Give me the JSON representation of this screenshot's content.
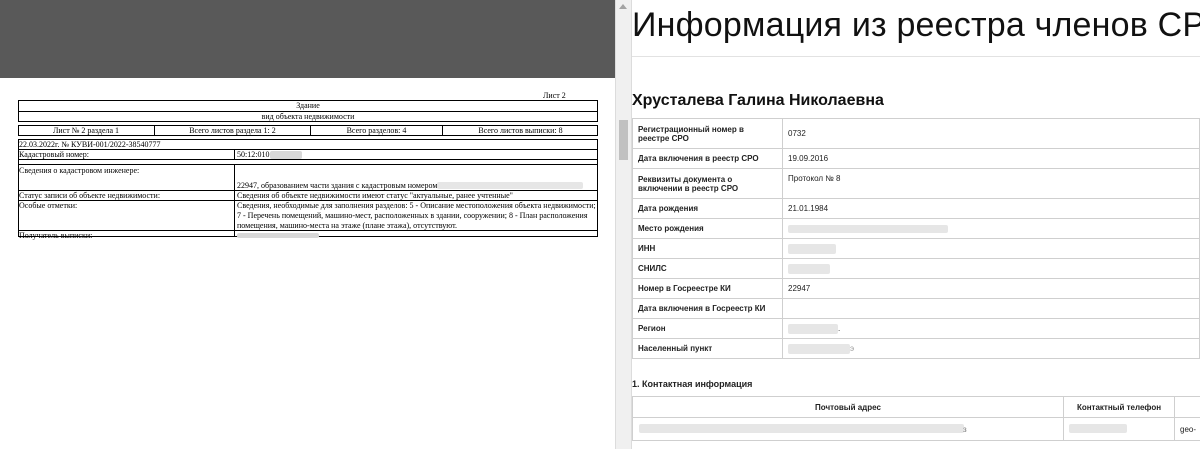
{
  "pdf": {
    "sheet_label": "Лист 2",
    "title": "Здание",
    "subtitle": "вид объекта недвижимости",
    "header_cells": [
      "Лист № 2 раздела 1",
      "Всего листов раздела 1: 2",
      "Всего разделов: 4",
      "Всего листов выписки: 8"
    ],
    "statement_line": "22.03.2022г. № КУВИ-001/2022-38540777",
    "cadastral_label": "Кадастровый номер:",
    "cadastral_value": "50:12:010",
    "engineer_label": "Сведения о кадастровом инженере:",
    "engineer_value": "22947, образованием части здания с кадастровым номером:",
    "status_label": "Статус записи об объекте недвижимости:",
    "status_value": "Сведения об объекте недвижимости имеют статус \"актуальные, ранее учтенные\"",
    "notes_label": "Особые отметки:",
    "notes_lines": [
      "Сведения, необходимые для заполнения разделов: 5 - Описание местоположения объекта недвижимости;",
      "7 - Перечень помещений, машино-мест, расположенных в здании, сооружении; 8 - План расположения",
      "помещения, машино-места на этаже (плане этажа), отсутствуют."
    ],
    "recipient_label": "Получатель выписки:"
  },
  "registry": {
    "page_title": "Информация из реестра членов СРО",
    "person_name": "Хрусталева Галина Николаевна",
    "rows": [
      {
        "label": "Регистрационный номер в реестре СРО",
        "value": "0732"
      },
      {
        "label": "Дата включения в реестр СРО",
        "value": "19.09.2016"
      },
      {
        "label": "Реквизиты документа о включении в реестр СРО",
        "value": "Протокол № 8"
      },
      {
        "label": "Дата рождения",
        "value": "21.01.1984"
      },
      {
        "label": "Место рождения",
        "value": ""
      },
      {
        "label": "ИНН",
        "value": ""
      },
      {
        "label": "СНИЛС",
        "value": ""
      },
      {
        "label": "Номер в Госреестре КИ",
        "value": "22947"
      },
      {
        "label": "Дата включения в Госреестр КИ",
        "value": ""
      },
      {
        "label": "Регион",
        "value": "."
      },
      {
        "label": "Населенный пункт",
        "value": "э"
      }
    ],
    "contacts_heading": "1. Контактная информация",
    "contacts_headers": [
      "Почтовый адрес",
      "Контактный телефон",
      ""
    ],
    "contacts_row": [
      "з",
      "",
      "geo-"
    ]
  }
}
